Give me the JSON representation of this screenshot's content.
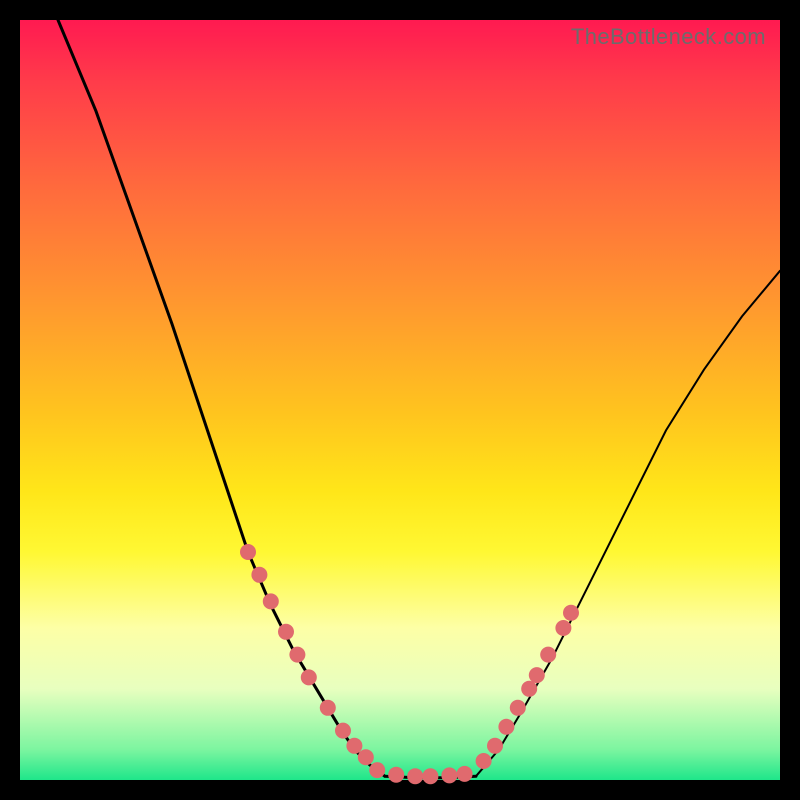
{
  "watermark": "TheBottleneck.com",
  "colors": {
    "frame": "#000000",
    "gradient_top": "#ff1a51",
    "gradient_bottom": "#1ee68a",
    "curve": "#000000",
    "bead": "#e06a6e"
  },
  "chart_data": {
    "type": "line",
    "title": "",
    "xlabel": "",
    "ylabel": "",
    "xlim": [
      0,
      100
    ],
    "ylim": [
      0,
      100
    ],
    "series": [
      {
        "name": "left-curve",
        "x": [
          5,
          10,
          15,
          20,
          25,
          28,
          30,
          33,
          36,
          39,
          42,
          44,
          46,
          48
        ],
        "y": [
          100,
          88,
          74,
          60,
          45,
          36,
          30,
          23,
          17,
          12,
          7,
          4,
          2,
          0.5
        ]
      },
      {
        "name": "valley-floor",
        "x": [
          48,
          52,
          56,
          60
        ],
        "y": [
          0.5,
          0.3,
          0.3,
          0.5
        ]
      },
      {
        "name": "right-curve",
        "x": [
          60,
          63,
          66,
          70,
          75,
          80,
          85,
          90,
          95,
          100
        ],
        "y": [
          0.5,
          4,
          9,
          16,
          26,
          36,
          46,
          54,
          61,
          67
        ]
      }
    ],
    "beads_left": [
      {
        "x": 30,
        "y": 30
      },
      {
        "x": 31.5,
        "y": 27
      },
      {
        "x": 33,
        "y": 23.5
      },
      {
        "x": 35,
        "y": 19.5
      },
      {
        "x": 36.5,
        "y": 16.5
      },
      {
        "x": 38,
        "y": 13.5
      },
      {
        "x": 40.5,
        "y": 9.5
      },
      {
        "x": 42.5,
        "y": 6.5
      },
      {
        "x": 44,
        "y": 4.5
      },
      {
        "x": 45.5,
        "y": 3
      }
    ],
    "beads_floor": [
      {
        "x": 47,
        "y": 1.3
      },
      {
        "x": 49.5,
        "y": 0.7
      },
      {
        "x": 52,
        "y": 0.5
      },
      {
        "x": 54,
        "y": 0.5
      },
      {
        "x": 56.5,
        "y": 0.6
      },
      {
        "x": 58.5,
        "y": 0.8
      }
    ],
    "beads_right": [
      {
        "x": 61,
        "y": 2.5
      },
      {
        "x": 62.5,
        "y": 4.5
      },
      {
        "x": 64,
        "y": 7
      },
      {
        "x": 65.5,
        "y": 9.5
      },
      {
        "x": 67,
        "y": 12
      },
      {
        "x": 68,
        "y": 13.8
      },
      {
        "x": 69.5,
        "y": 16.5
      },
      {
        "x": 71.5,
        "y": 20
      },
      {
        "x": 72.5,
        "y": 22
      }
    ]
  }
}
